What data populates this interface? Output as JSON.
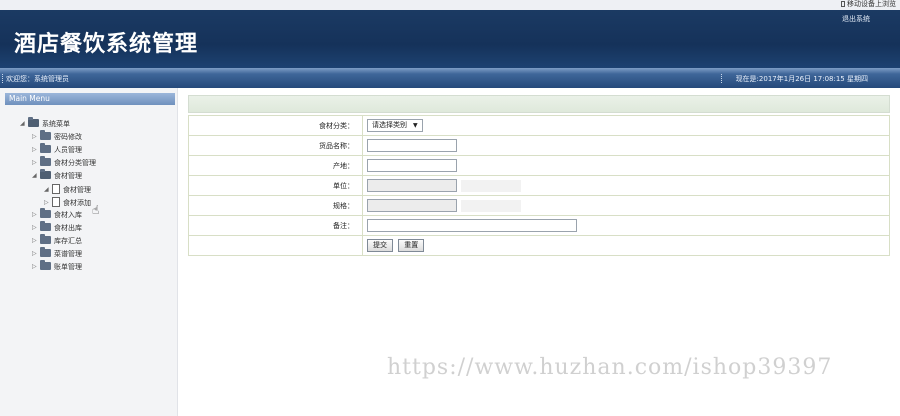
{
  "top_strip": {
    "mobile_link": "移动设备上浏览"
  },
  "header": {
    "title": "酒店餐饮系统管理",
    "logout": "退出系统"
  },
  "statusbar": {
    "welcome": "欢迎您：系统管理员",
    "datetime": "现在是:2017年1月26日 17:08:15 星期四"
  },
  "sidebar": {
    "menu_title": "Main Menu",
    "root": "系统菜单",
    "items": [
      {
        "label": "密码修改"
      },
      {
        "label": "人员管理"
      },
      {
        "label": "食材分类管理"
      },
      {
        "label": "食材管理",
        "children": [
          "食材管理",
          "食材添加"
        ]
      },
      {
        "label": "食材入库"
      },
      {
        "label": "食材出库"
      },
      {
        "label": "库存汇总"
      },
      {
        "label": "菜谱管理"
      },
      {
        "label": "账单管理"
      }
    ]
  },
  "form": {
    "category_label": "食材分类：",
    "category_value": "请选择类别",
    "name_label": "货品名称：",
    "origin_label": "产地：",
    "unit_label": "单位：",
    "spec_label": "规格：",
    "remark_label": "备注：",
    "submit": "提交",
    "reset": "重置"
  },
  "watermark": "https://www.huzhan.com/ishop39397",
  "icons": {
    "folder": "folder-icon",
    "file": "file-icon",
    "cursor": "hand-cursor-icon"
  },
  "colors": {
    "banner": "#1b3a63",
    "statusbar": "#25497a",
    "menu_header": "#6f90bd"
  }
}
